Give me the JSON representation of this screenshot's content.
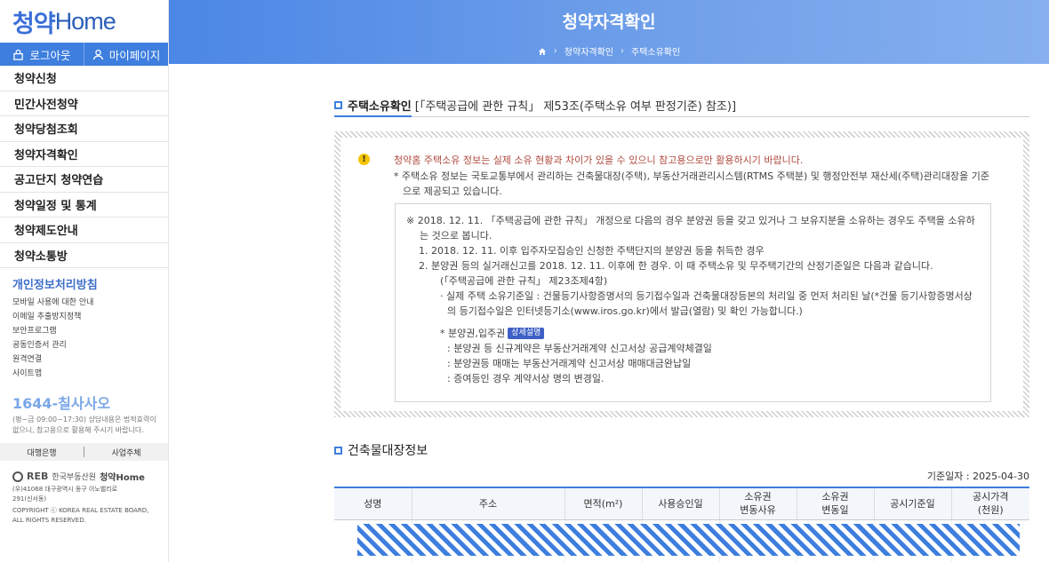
{
  "sidebar": {
    "logo_ko": "청약",
    "logo_en": "Home",
    "logout": "로그아웃",
    "mypage": "마이페이지",
    "menu": [
      "청약신청",
      "민간사전청약",
      "청약당첨조회",
      "청약자격확인",
      "공고단지 청약연습",
      "청약일정 및 통계",
      "청약제도안내",
      "청약소통방"
    ],
    "privacy_title": "개인정보처리방침",
    "sub_links": [
      "모바일 사용에 대한 안내",
      "이메일 추출방지정책",
      "보안프로그램",
      "공동인증서 관리",
      "원격연결",
      "사이트맵"
    ],
    "phone": "1644-칠사사오",
    "hours": [
      "(평~금 09:00~17:30) 상담내용은 법적효력이",
      "없으니, 참고용으로 활용해 주시기 바랍니다."
    ],
    "quick_bank": "대행은행",
    "quick_biz": "사업주체",
    "footer_reb": "REB",
    "footer_org": "한국부동산원",
    "footer_brand": "청약Home",
    "address": [
      "(우)41068 대구광역시 동구 이노밸리로",
      "291(신서동)"
    ],
    "copyright": [
      "COPYRIGHT ⓒ KOREA REAL ESTATE BOARD,",
      "ALL RIGHTS RESERVED."
    ]
  },
  "header": {
    "title": "청약자격확인",
    "crumb1": "청약자격확인",
    "crumb2": "주택소유확인"
  },
  "section1": {
    "title": "주택소유확인",
    "ref": "[「주택공급에 관한 규칙」 제53조(주택소유 여부 판정기준) 참조)]"
  },
  "notice": {
    "red": "청약홈 주택소유 정보는 실제 소유 현황과 차이가 있을 수 있으니 참고용으로만 활용하시기 바랍니다.",
    "info": "* 주택소유 정보는 국토교통부에서 관리하는 건축물대장(주택), 부동산거래관리시스템(RTMS 주택분) 및 행정안전부 재산세(주택)관리대장을 기준으로 제공되고 있습니다.",
    "p1": "※ 2018. 12. 11. 「주택공급에 관한 규칙」 개정으로 다음의 경우 분양권 등을 갖고 있거나 그 보유지분을 소유하는 경우도 주택을 소유하는 것으로 봅니다.",
    "l1": "1. 2018. 12. 11. 이후 입주자모집승인 신청한 주택단지의 분양권 등을 취득한 경우",
    "l2": "2. 분양권 등의 실거래신고를 2018. 12. 11. 이후에 한 경우. 이 때 주택소유 및 무주택기간의 산정기준일은 다음과 같습니다.",
    "l2b": "(「주택공급에 관한 규칙」 제23조제4항)",
    "l3": "· 실제 주택 소유기준일 : 건물등기사항증명서의 등기접수일과 건축물대장등본의 처리일 중 먼저 처리된 날(*건물 등기사항증명서상의 등기접수일은 인터넷등기소(www.iros.go.kr)에서 발급(열람) 및 확인 가능합니다.)",
    "l4": "* 분양권,입주권",
    "detail_btn": "상세설명",
    "l5a": ": 분양권 등 신규계약은 부동산거래계약 신고서상 공급계약체결일",
    "l5b": ": 분양권등 매매는 부동산거래계약 신고서상 매매대금완납일",
    "l5c": ": 증여등인 경우 계약서상 명의 변경일."
  },
  "section2": {
    "title": "건축물대장정보",
    "base_date": "기준일자 : 2025-04-30",
    "columns": [
      "성명",
      "주소",
      "면적(m²)",
      "사용승인일",
      "소유권\n변동사유",
      "소유권\n변동일",
      "공시기준일",
      "공시가격\n(천원)"
    ]
  },
  "colors": {
    "accent": "#3d7ede",
    "warn_text": "#b04b3f",
    "badge": "#3d5fc6"
  }
}
